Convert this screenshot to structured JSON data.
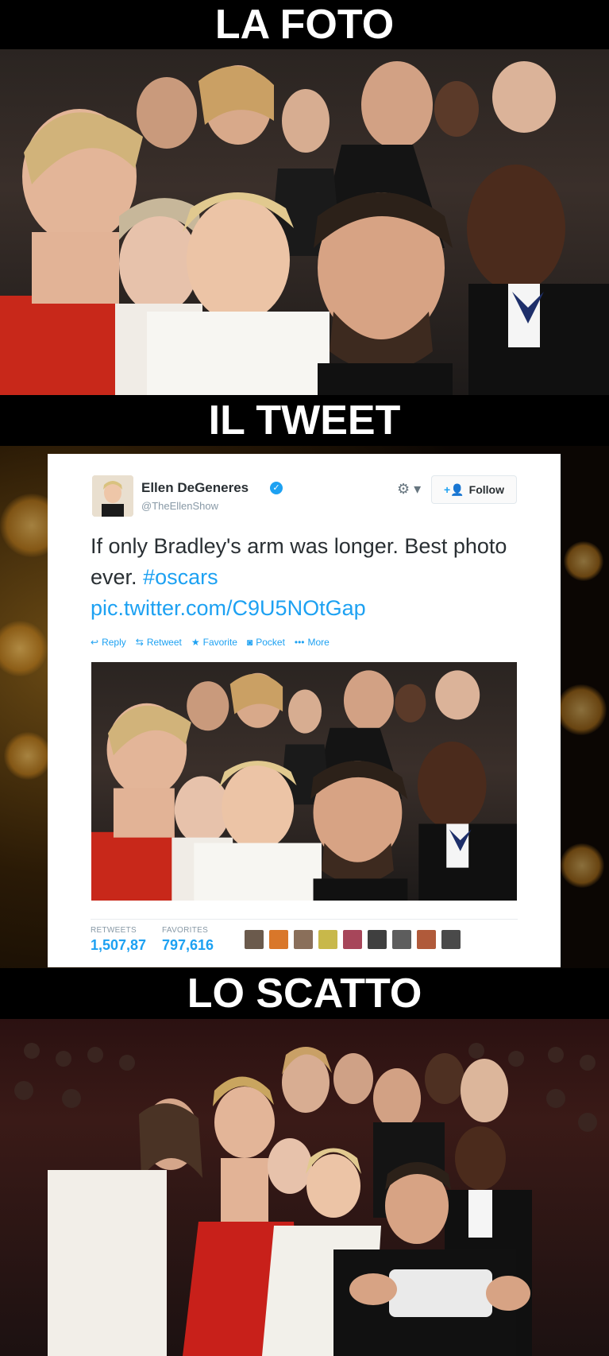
{
  "banners": {
    "top": "LA FOTO",
    "middle": "IL TWEET",
    "bottom": "LO SCATTO"
  },
  "tweet": {
    "name": "Ellen DeGeneres",
    "handle": "@TheEllenShow",
    "follow_label": "Follow",
    "text": "If only Bradley's arm was longer. Best photo ever.",
    "hashtag": "#oscars",
    "link": "pic.twitter.com/C9U5NOtGap",
    "actions": {
      "reply": "Reply",
      "retweet": "Retweet",
      "favorite": "Favorite",
      "pocket": "Pocket",
      "more": "More"
    },
    "stats": {
      "retweets_label": "RETWEETS",
      "retweets_value": "1,507,87",
      "favorites_label": "FAVORITES",
      "favorites_value": "797,616"
    }
  },
  "colors": {
    "banner_bg": "#000000",
    "twitter_blue": "#1da1f2",
    "card_bg": "#ffffff"
  },
  "icons": [
    "verified-badge-icon",
    "gear-icon",
    "follow-person-icon",
    "reply-icon",
    "retweet-icon",
    "favorite-star-icon",
    "pocket-icon",
    "more-dots-icon"
  ]
}
